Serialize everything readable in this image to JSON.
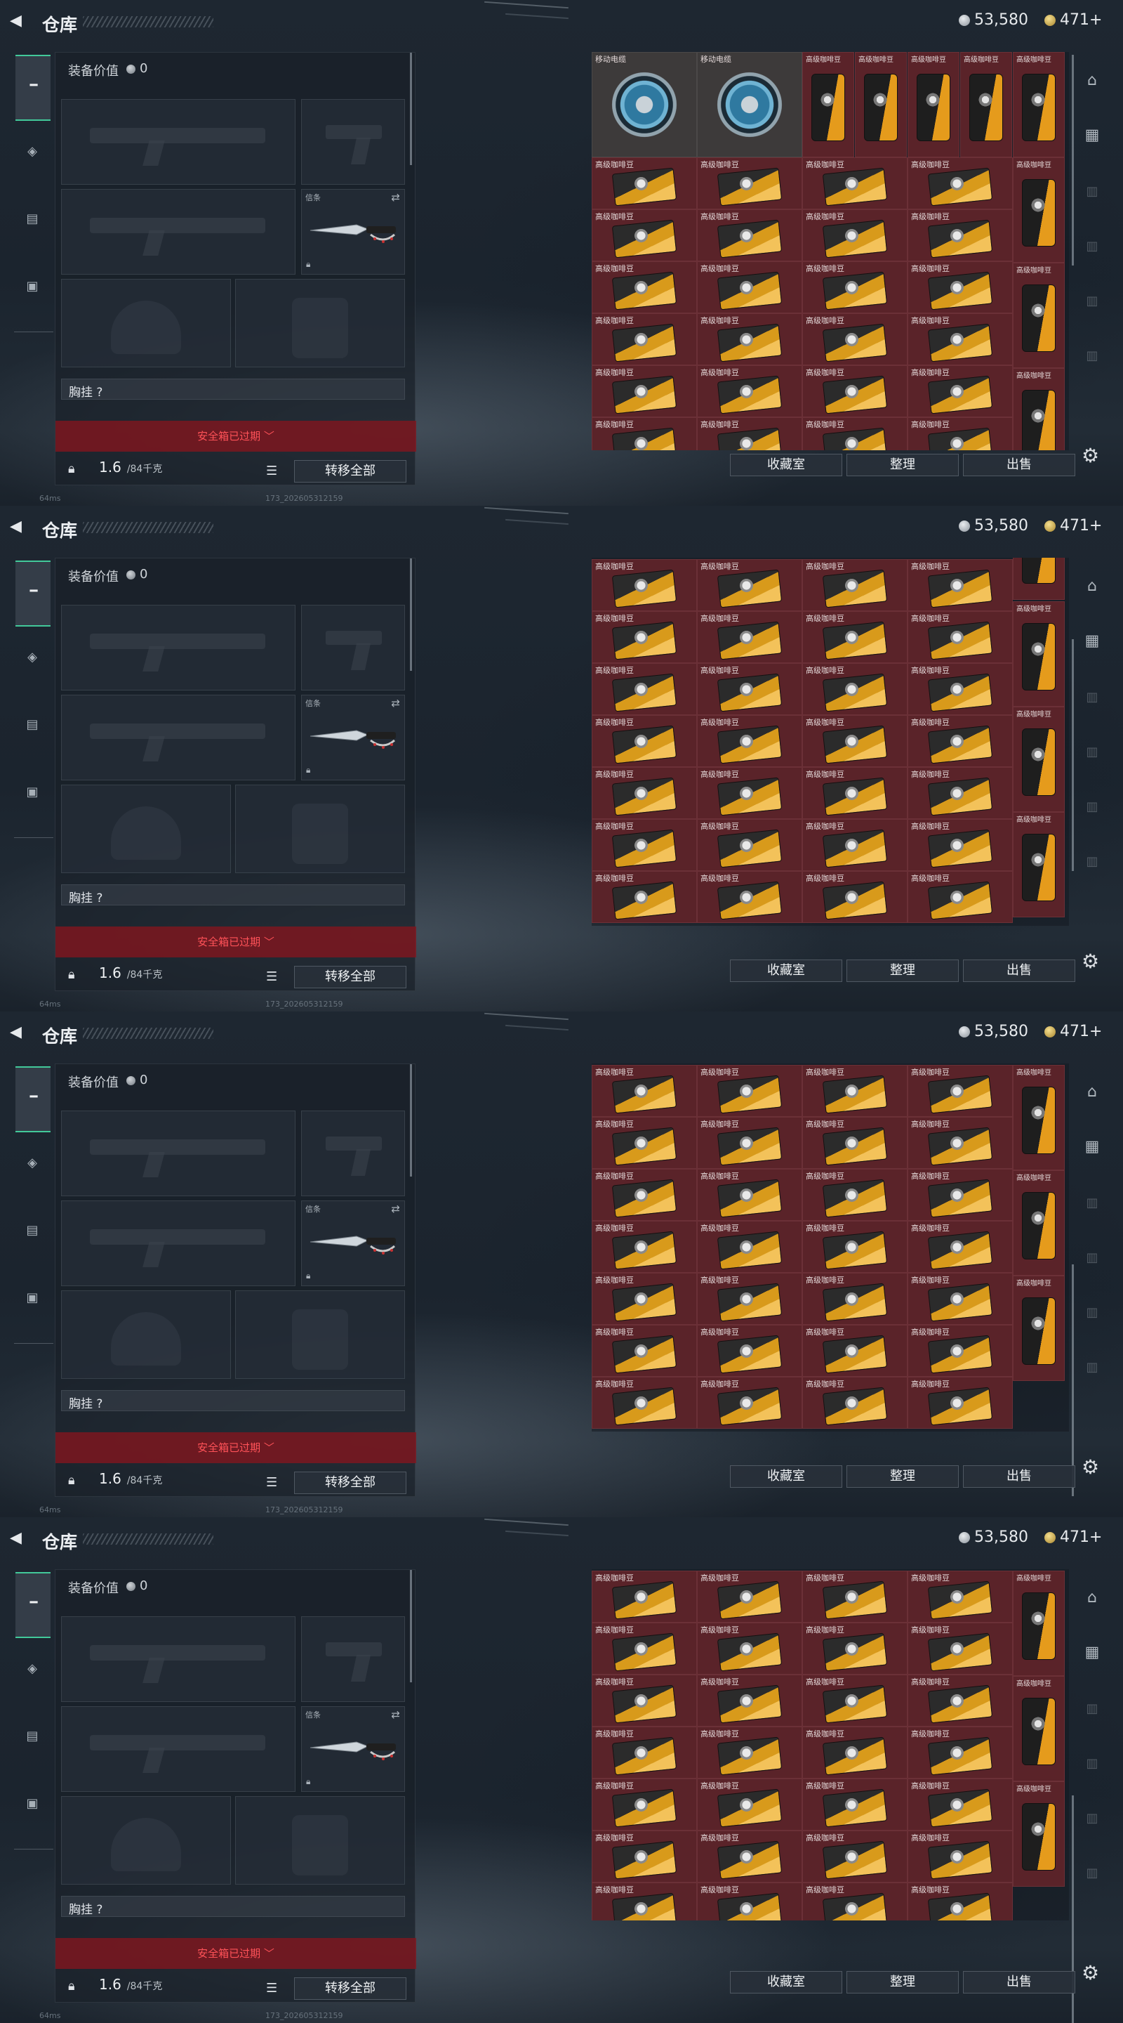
{
  "header": {
    "title": "仓库",
    "silver": "53,580",
    "gold": "471+"
  },
  "panel": {
    "value_label": "装备价值",
    "value": "0",
    "melee_label": "信条",
    "chest_label": "胸挂  ?",
    "safe_box": "安全箱已过期 ﹀",
    "weight": "1.6",
    "weight_cap": "/84千克",
    "transfer_all": "转移全部"
  },
  "inventory": {
    "item_reel": "移动电缆",
    "item_coffee": "高级咖啡豆",
    "btn_collection": "收藏室",
    "btn_sort": "整理",
    "btn_sell": "出售"
  },
  "footer": {
    "ping": "64ms",
    "build": "173_202605312159"
  },
  "frames": [
    {
      "variant": "top"
    },
    {
      "variant": "mid1"
    },
    {
      "variant": "mid2"
    },
    {
      "variant": "bottom"
    }
  ]
}
